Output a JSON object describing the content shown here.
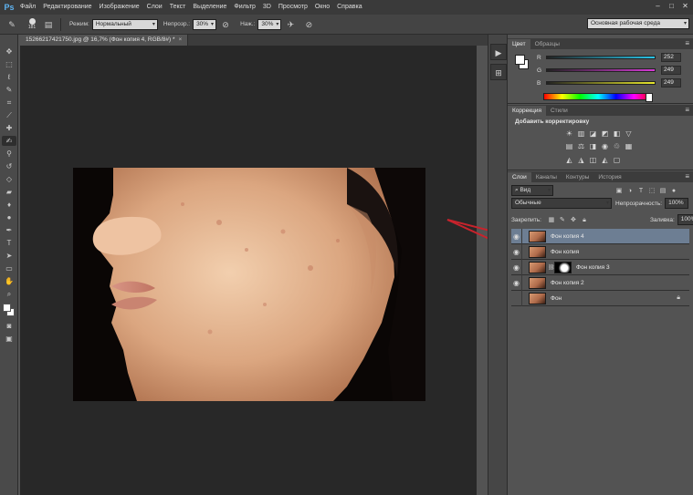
{
  "app": {
    "logo": "Ps"
  },
  "menu": [
    "Файл",
    "Редактирование",
    "Изображение",
    "Слои",
    "Текст",
    "Выделение",
    "Фильтр",
    "3D",
    "Просмотр",
    "Окно",
    "Справка"
  ],
  "window_controls": [
    "–",
    "□",
    "✕"
  ],
  "options": {
    "brush_size": "181",
    "mode_label": "Режим:",
    "mode_value": "Нормальный",
    "opacity_label": "Непрозр.:",
    "opacity_value": "30%",
    "flow_label": "Наж.:",
    "flow_value": "30%",
    "workspace": "Основная рабочая среда"
  },
  "document_tab": {
    "title": "1526621742175​0.jpg @ 16,7% (Фон копия 4, RGB/8#) *",
    "close": "×"
  },
  "tools": [
    "move-tool",
    "marquee-tool",
    "lasso-tool",
    "quick-select-tool",
    "crop-tool",
    "eyedropper-tool",
    "healing-tool",
    "brush-tool",
    "clone-stamp-tool",
    "history-brush-tool",
    "eraser-tool",
    "gradient-tool",
    "blur-tool",
    "dodge-tool",
    "pen-tool",
    "type-tool",
    "path-select-tool",
    "shape-tool",
    "hand-tool",
    "zoom-tool"
  ],
  "color_panel": {
    "tabs": [
      "Цвет",
      "Образцы"
    ],
    "channels": [
      {
        "label": "R",
        "value": "252",
        "color": "#29c4e8"
      },
      {
        "label": "G",
        "value": "249",
        "color": "#d63ad6"
      },
      {
        "label": "B",
        "value": "249",
        "color": "#e6e62c"
      }
    ]
  },
  "adjustments_panel": {
    "tabs": [
      "Коррекция",
      "Стили"
    ],
    "title": "Добавить корректировку",
    "row1": [
      "☀",
      "▥",
      "◪",
      "◩",
      "◧",
      "▽"
    ],
    "row2": [
      "▤",
      "⚖",
      "◨",
      "◉",
      "♲",
      "▦"
    ],
    "row3": [
      "◭",
      "◮",
      "◫",
      "◭",
      "▢"
    ]
  },
  "layers_panel": {
    "tabs": [
      "Слои",
      "Каналы",
      "Контуры",
      "История"
    ],
    "filter": "Вид",
    "blend_mode": "Обычные",
    "opacity_label": "Непрозрачность:",
    "opacity_value": "100%",
    "lock_label": "Закрепить:",
    "fill_label": "Заливка:",
    "fill_value": "100%",
    "layers": [
      {
        "name": "Фон копия 4",
        "visible": true,
        "selected": true,
        "mask": false,
        "locked": false
      },
      {
        "name": "Фон копия",
        "visible": true,
        "selected": false,
        "mask": false,
        "locked": false
      },
      {
        "name": "Фон копия 3",
        "visible": true,
        "selected": false,
        "mask": true,
        "locked": false
      },
      {
        "name": "Фон копия 2",
        "visible": true,
        "selected": false,
        "mask": false,
        "locked": false
      },
      {
        "name": "Фон",
        "visible": false,
        "selected": false,
        "mask": false,
        "locked": true
      }
    ]
  },
  "colors": {
    "annotation_arrow": "#c8232c",
    "selected_layer": "#6d7e93"
  }
}
